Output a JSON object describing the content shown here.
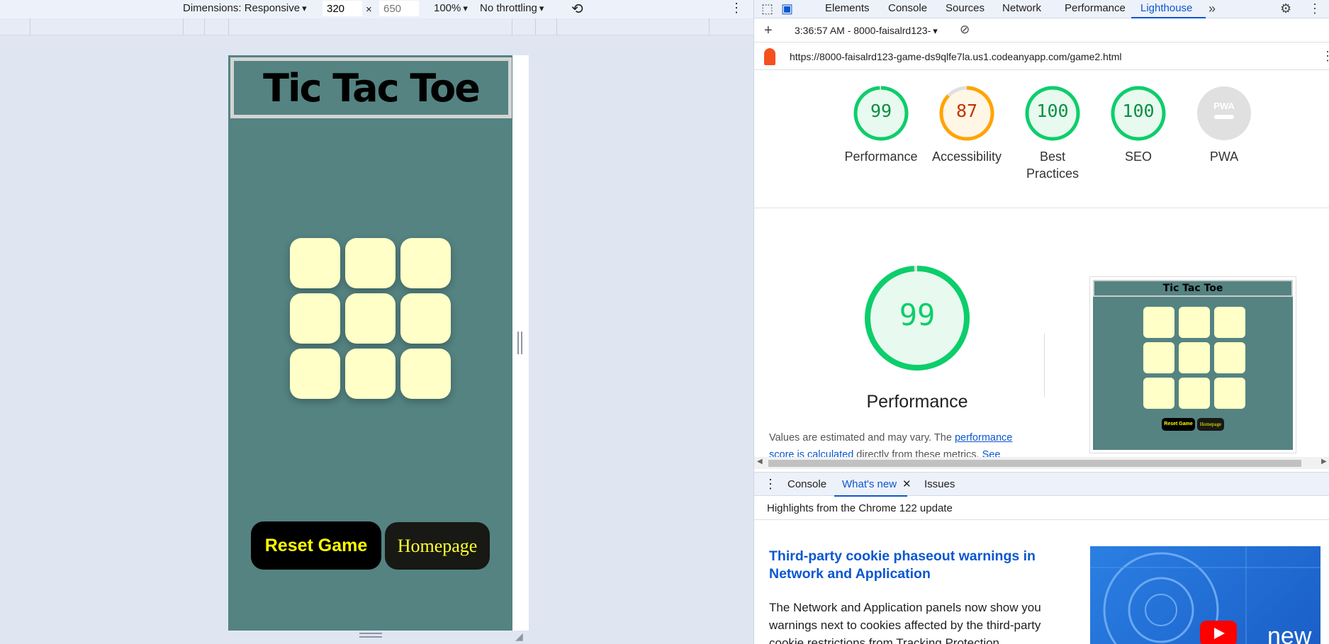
{
  "device_toolbar": {
    "dimensions_label": "Dimensions: Responsive",
    "width": "320",
    "x_sign": "×",
    "height_placeholder": "650",
    "zoom": "100%",
    "throttling": "No throttling"
  },
  "emulated_page": {
    "title": "Tic Tac Toe",
    "cells": [
      "",
      "",
      "",
      "",
      "",
      "",
      "",
      "",
      ""
    ],
    "reset_label": "Reset Game",
    "homepage_label": "Homepage",
    "colors": {
      "background": "#548382",
      "cell": "#ffffc7",
      "reset_bg": "#000000",
      "button_text": "#ffff00"
    }
  },
  "devtools": {
    "tabs": [
      "Elements",
      "Console",
      "Sources",
      "Network",
      "Performance",
      "Lighthouse"
    ],
    "active_tab": "Lighthouse",
    "report_time": "3:36:57 AM - 8000-faisalrd123-",
    "url": "https://8000-faisalrd123-game-ds9qlfe7la.us1.codeanyapp.com/game2.html",
    "scores": [
      {
        "label": "Performance",
        "value": "99",
        "color": "#0cce6b",
        "fill": 0.99
      },
      {
        "label": "Accessibility",
        "value": "87",
        "color": "#ffa400",
        "fill": 0.87
      },
      {
        "label": "Best Practices",
        "value": "100",
        "color": "#0cce6b",
        "fill": 1.0
      },
      {
        "label": "SEO",
        "value": "100",
        "color": "#0cce6b",
        "fill": 1.0
      },
      {
        "label": "PWA",
        "value": "PWA",
        "color": "#9e9e9e",
        "fill": 0
      }
    ],
    "performance_big": {
      "value": "99",
      "label": "Performance",
      "fill": 0.99
    },
    "perf_note": {
      "prefix": "Values are estimated and may vary. The ",
      "link": "performance score is calculated",
      "suffix": " directly from these metrics. ",
      "see": "See"
    },
    "thumbnail": {
      "title": "Tic Tac Toe",
      "reset": "Reset Game",
      "home": "Homepage"
    },
    "drawer": {
      "tabs": [
        "Console",
        "What's new",
        "Issues"
      ],
      "active_tab": "What's new",
      "header": "Highlights from the Chrome 122 update",
      "article_title": "Third-party cookie phaseout warnings in Network and Application",
      "article_body": "The Network and Application panels now show you warnings next to cookies affected by the third-party cookie restrictions from Tracking Protection.",
      "image_text": "new"
    }
  }
}
